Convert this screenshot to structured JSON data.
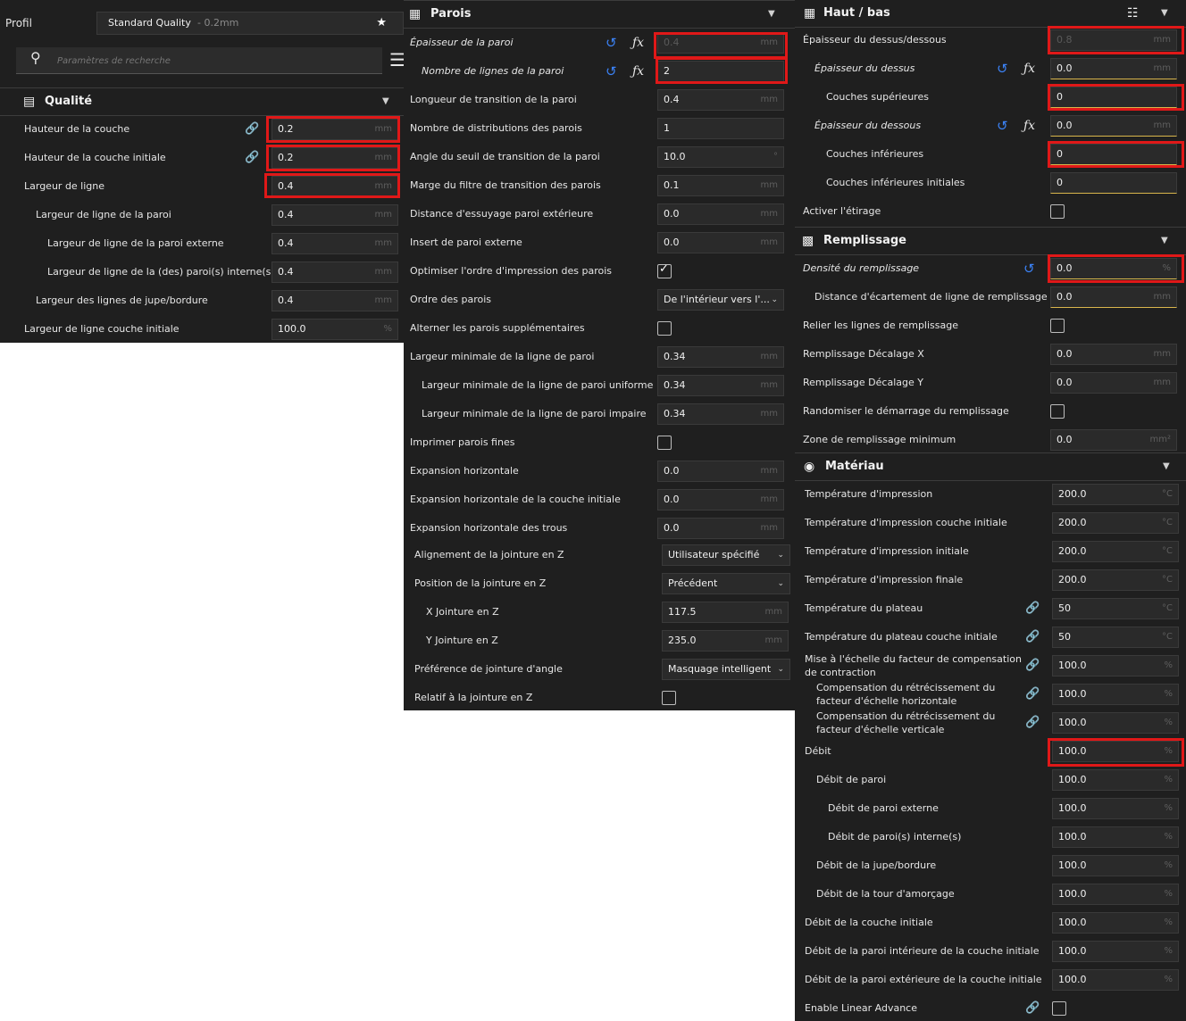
{
  "left": {
    "profile_label": "Profil",
    "profile_name": "Standard Quality",
    "profile_detail": "- 0.2mm",
    "search_placeholder": "Paramètres de recherche",
    "section_title": "Qualité",
    "rows": [
      {
        "label": "Hauteur de la couche",
        "value": "0.2",
        "unit": "mm"
      },
      {
        "label": "Hauteur de la couche initiale",
        "value": "0.2",
        "unit": "mm"
      },
      {
        "label": "Largeur de ligne",
        "value": "0.4",
        "unit": "mm"
      },
      {
        "label": "Largeur de ligne de la paroi",
        "value": "0.4",
        "unit": "mm"
      },
      {
        "label": "Largeur de ligne de la paroi externe",
        "value": "0.4",
        "unit": "mm"
      },
      {
        "label": "Largeur de ligne de la (des) paroi(s) interne(s)",
        "value": "0.4",
        "unit": "mm"
      },
      {
        "label": "Largeur des lignes de jupe/bordure",
        "value": "0.4",
        "unit": "mm"
      },
      {
        "label": "Largeur de ligne couche initiale",
        "value": "100.0",
        "unit": "%"
      }
    ]
  },
  "mid": {
    "section_title": "Parois",
    "rows": [
      {
        "label": "Épaisseur de la paroi",
        "value": "0.4",
        "unit": "mm"
      },
      {
        "label": "Nombre de lignes de la paroi",
        "value": "2",
        "unit": ""
      },
      {
        "label": "Longueur de transition de la paroi",
        "value": "0.4",
        "unit": "mm"
      },
      {
        "label": "Nombre de distributions des parois",
        "value": "1",
        "unit": ""
      },
      {
        "label": "Angle du seuil de transition de la paroi",
        "value": "10.0",
        "unit": "°"
      },
      {
        "label": "Marge du filtre de transition des parois",
        "value": "0.1",
        "unit": "mm"
      },
      {
        "label": "Distance d'essuyage paroi extérieure",
        "value": "0.0",
        "unit": "mm"
      },
      {
        "label": "Insert de paroi externe",
        "value": "0.0",
        "unit": "mm"
      },
      {
        "label": "Optimiser l'ordre d'impression des parois"
      },
      {
        "label": "Ordre des parois",
        "value": "De l'intérieur vers l'..."
      },
      {
        "label": "Alterner les parois supplémentaires"
      },
      {
        "label": "Largeur minimale de la ligne de paroi",
        "value": "0.34",
        "unit": "mm"
      },
      {
        "label": "Largeur minimale de la ligne de paroi uniforme",
        "value": "0.34",
        "unit": "mm"
      },
      {
        "label": "Largeur minimale de la ligne de paroi impaire",
        "value": "0.34",
        "unit": "mm"
      },
      {
        "label": "Imprimer parois fines"
      },
      {
        "label": "Expansion horizontale",
        "value": "0.0",
        "unit": "mm"
      },
      {
        "label": "Expansion horizontale de la couche initiale",
        "value": "0.0",
        "unit": "mm"
      },
      {
        "label": "Expansion horizontale des trous",
        "value": "0.0",
        "unit": "mm"
      },
      {
        "label": "Alignement de la jointure en Z",
        "value": "Utilisateur spécifié"
      },
      {
        "label": "Position de la jointure en Z",
        "value": "Précédent"
      },
      {
        "label": "X Jointure en Z",
        "value": "117.5",
        "unit": "mm"
      },
      {
        "label": "Y Jointure en Z",
        "value": "235.0",
        "unit": "mm"
      },
      {
        "label": "Préférence de jointure d'angle",
        "value": "Masquage intelligent"
      },
      {
        "label": "Relatif à la jointure en Z"
      }
    ]
  },
  "right_top": {
    "section_title": "Haut / bas",
    "rows": [
      {
        "label": "Épaisseur du dessus/dessous",
        "value": "0.8",
        "unit": "mm"
      },
      {
        "label": "Épaisseur du dessus",
        "value": "0.0",
        "unit": "mm"
      },
      {
        "label": "Couches supérieures",
        "value": "0",
        "unit": ""
      },
      {
        "label": "Épaisseur du dessous",
        "value": "0.0",
        "unit": "mm"
      },
      {
        "label": "Couches inférieures",
        "value": "0",
        "unit": ""
      },
      {
        "label": "Couches inférieures initiales",
        "value": "0",
        "unit": ""
      },
      {
        "label": "Activer l'étirage"
      }
    ]
  },
  "right_infill": {
    "section_title": "Remplissage",
    "rows": [
      {
        "label": "Densité du remplissage",
        "value": "0.0",
        "unit": "%"
      },
      {
        "label": "Distance d'écartement de ligne de remplissage",
        "value": "0.0",
        "unit": "mm"
      },
      {
        "label": "Relier les lignes de remplissage"
      },
      {
        "label": "Remplissage Décalage X",
        "value": "0.0",
        "unit": "mm"
      },
      {
        "label": "Remplissage Décalage Y",
        "value": "0.0",
        "unit": "mm"
      },
      {
        "label": "Randomiser le démarrage du remplissage"
      },
      {
        "label": "Zone de remplissage minimum",
        "value": "0.0",
        "unit": "mm²"
      }
    ]
  },
  "right_material": {
    "section_title": "Matériau",
    "rows": [
      {
        "label": "Température d'impression",
        "value": "200.0",
        "unit": "°C"
      },
      {
        "label": "Température d'impression couche initiale",
        "value": "200.0",
        "unit": "°C"
      },
      {
        "label": "Température d'impression initiale",
        "value": "200.0",
        "unit": "°C"
      },
      {
        "label": "Température d'impression finale",
        "value": "200.0",
        "unit": "°C"
      },
      {
        "label": "Température du plateau",
        "value": "50",
        "unit": "°C"
      },
      {
        "label": "Température du plateau couche initiale",
        "value": "50",
        "unit": "°C"
      },
      {
        "label": "Mise à l'échelle du facteur de compensation de contraction",
        "value": "100.0",
        "unit": "%"
      },
      {
        "label": "Compensation du rétrécissement du facteur d'échelle horizontale",
        "value": "100.0",
        "unit": "%"
      },
      {
        "label": "Compensation du rétrécissement du facteur d'échelle verticale",
        "value": "100.0",
        "unit": "%"
      },
      {
        "label": "Débit",
        "value": "100.0",
        "unit": "%"
      },
      {
        "label": "Débit de paroi",
        "value": "100.0",
        "unit": "%"
      },
      {
        "label": "Débit de paroi externe",
        "value": "100.0",
        "unit": "%"
      },
      {
        "label": "Débit de paroi(s) interne(s)",
        "value": "100.0",
        "unit": "%"
      },
      {
        "label": "Débit de la jupe/bordure",
        "value": "100.0",
        "unit": "%"
      },
      {
        "label": "Débit de la tour d'amorçage",
        "value": "100.0",
        "unit": "%"
      },
      {
        "label": "Débit de la couche initiale",
        "value": "100.0",
        "unit": "%"
      },
      {
        "label": "Débit de la paroi intérieure de la couche initiale",
        "value": "100.0",
        "unit": "%"
      },
      {
        "label": "Débit de la paroi extérieure de la couche initiale",
        "value": "100.0",
        "unit": "%"
      },
      {
        "label": "Enable Linear Advance"
      }
    ]
  },
  "colors": {
    "panel_bg": "#1f1f1f",
    "input_bg": "#2a2a2a",
    "highlight": "#e01818",
    "accent_blue": "#3b82f6",
    "override_yellow": "#d9b64c"
  }
}
